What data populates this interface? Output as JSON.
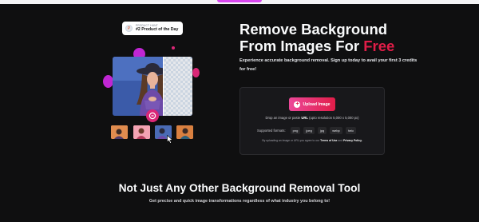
{
  "badge": {
    "overline": "PRODUCT HUNT",
    "title": "#2 Product of the Day",
    "logo_letter": "P"
  },
  "hero": {
    "headline_line1": "Remove Background",
    "headline_line2_prefix": "From Images For ",
    "headline_accent": "Free",
    "subtext": "Experience accurate background removal. Sign up today to avail your first 3 credits for free!"
  },
  "upload": {
    "button_label": "Upload Image",
    "drop_prefix": "Drop an image or paste ",
    "drop_url": "URL",
    "drop_suffix": " (upto resolution 5,000 x 5,000 px)",
    "formats_label": "Supported formats:",
    "formats": [
      "png",
      "jpeg",
      "jpg",
      "webp",
      "heic"
    ],
    "terms_prefix": "By uploading an Image or URL you agree to our ",
    "terms_link": "Terms of Use",
    "terms_mid": " and ",
    "privacy_link": "Privacy Policy."
  },
  "section2": {
    "title": "Not Just Any Other Background Removal Tool",
    "subtitle": "Get precise and quick image transformations regardless of what industry you belong to!"
  },
  "colors": {
    "accent": "#e11d48",
    "accent_gradient_start": "#ec4899",
    "background": "#0f0f10",
    "panel": "#18181b",
    "blob_magenta": "#c026d3",
    "blob_pink": "#db2777"
  },
  "icons": {
    "upload": "plus-circle-icon",
    "cursor": "mouse-pointer-icon",
    "eraser": "eraser-icon"
  }
}
